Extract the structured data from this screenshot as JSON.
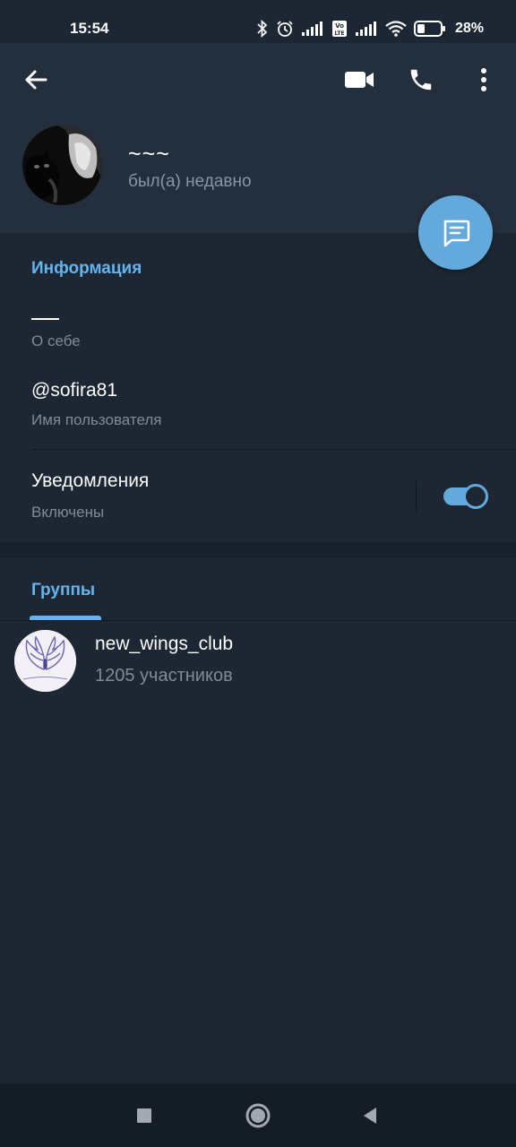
{
  "status_bar": {
    "time": "15:54",
    "battery": "28%",
    "icons": [
      "bluetooth-icon",
      "alarm-icon",
      "signal-icon",
      "volte-icon",
      "signal-icon",
      "wifi-icon",
      "battery-icon"
    ]
  },
  "header": {
    "back_icon": "arrow-left-icon",
    "video_icon": "video-camera-icon",
    "call_icon": "phone-icon",
    "more_icon": "more-vertical-icon"
  },
  "profile": {
    "name": "~~~",
    "status": "был(а) недавно"
  },
  "fab": {
    "icon": "message-icon"
  },
  "info": {
    "title": "Информация",
    "about_value": "",
    "about_label": "О себе",
    "username_value": "@sofira81",
    "username_label": "Имя пользователя",
    "notifications_value": "Уведомления",
    "notifications_label": "Включены",
    "notifications_enabled": true
  },
  "groups": {
    "tab_label": "Группы",
    "items": [
      {
        "name": "new_wings_club",
        "members": "1205 участников",
        "avatar_caption": "Новые крылья"
      }
    ]
  },
  "colors": {
    "background": "#1d2733",
    "header": "#242f3d",
    "accent": "#64a9dc",
    "accent_text": "#64b5ef",
    "secondary_text": "#7d8b99"
  },
  "nav": {
    "recent_icon": "square-icon",
    "home_icon": "circle-icon",
    "back_icon": "triangle-back-icon"
  }
}
